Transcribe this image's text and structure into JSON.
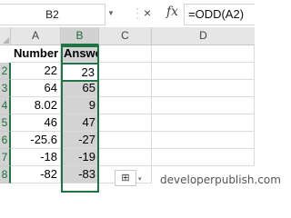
{
  "formula_bar": {
    "name_box": "B2",
    "separator": "⋮",
    "cancel_icon": "×",
    "enter_icon": "✓",
    "fx_label": "fx",
    "formula": "=ODD(A2)"
  },
  "columns": [
    "A",
    "B",
    "C",
    "D"
  ],
  "rows": [
    "2",
    "3",
    "4",
    "5",
    "6",
    "7",
    "8"
  ],
  "headers": {
    "number": "Number",
    "answer": "Answer"
  },
  "data": {
    "A": [
      "22",
      "64",
      "8.02",
      "46",
      "-25.6",
      "-18",
      "-82"
    ],
    "B": [
      "23",
      "65",
      "9",
      "47",
      "-27",
      "-19",
      "-83"
    ]
  },
  "selection": {
    "active_cell": "B2",
    "range": "B1:B8",
    "selected_column": "B"
  },
  "quick_analysis": {
    "icon": "quick-analysis-icon",
    "glyph": "⊞",
    "caret": "▾"
  },
  "watermark": "developerpublish.com",
  "colors": {
    "selection_green": "#217346",
    "header_bg": "#e6e6e6",
    "selected_bg": "#d3d3d3"
  }
}
